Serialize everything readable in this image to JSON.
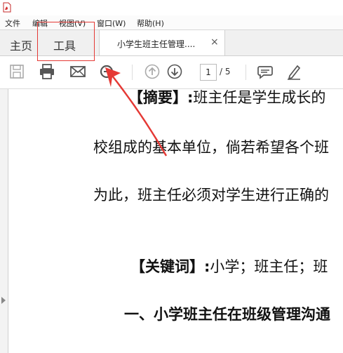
{
  "menubar": {
    "items": [
      "文件",
      "编辑",
      "视图(V)",
      "窗口(W)",
      "帮助(H)"
    ]
  },
  "tabs": {
    "home": "主页",
    "tools": "工具",
    "document": "小学生班主任管理....",
    "close": "×"
  },
  "toolbar": {
    "page_current": "1",
    "page_total": "/ 5"
  },
  "document": {
    "line1_bold": "【摘要】:",
    "line1_text": "班主任是学生成长的",
    "line2": "校组成的基本单位，倘若希望各个班",
    "line3": "为此，班主任必须对学生进行正确的",
    "line4_bold": "【关键词】:",
    "line4_text": "小学；班主任；班",
    "line5": "一、小学班主任在班级管理沟通"
  },
  "colors": {
    "highlight": "#e53935",
    "icon_gray": "#555555",
    "pdf_red": "#d32f2f"
  },
  "icons": [
    "adobe-pdf-icon",
    "save-icon",
    "print-icon",
    "email-icon",
    "zoom-icon",
    "prev-page-icon",
    "next-page-icon",
    "comment-icon",
    "sign-icon",
    "close-icon"
  ]
}
